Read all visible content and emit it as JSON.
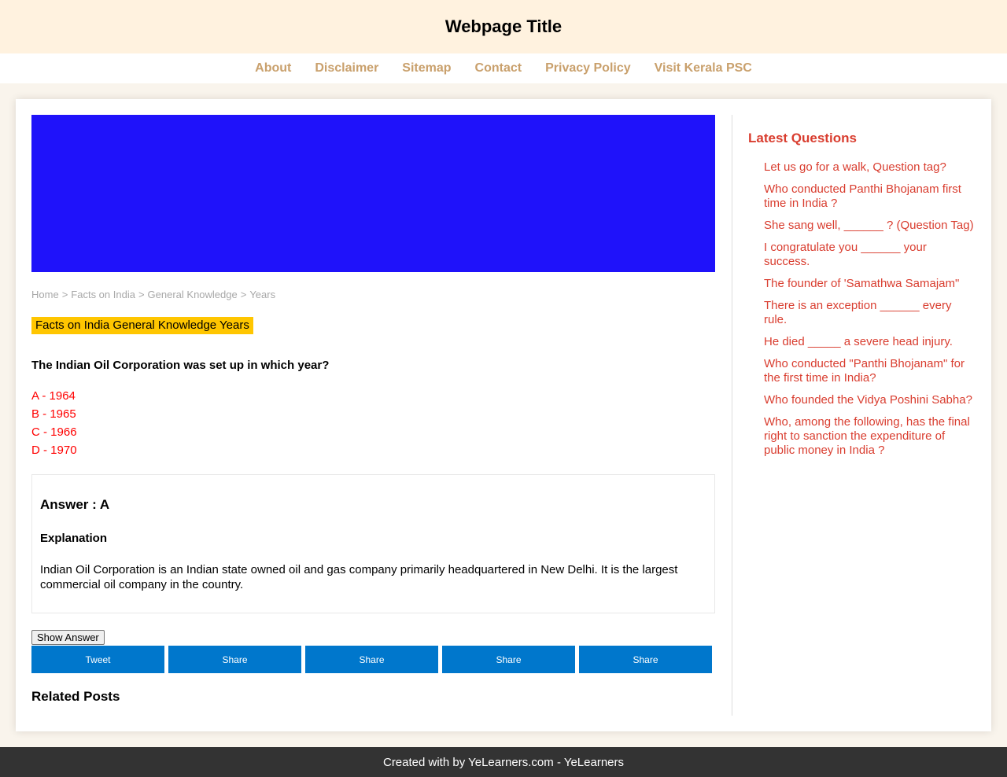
{
  "header": {
    "title": "Webpage Title"
  },
  "nav": [
    {
      "label": "About"
    },
    {
      "label": "Disclaimer"
    },
    {
      "label": "Sitemap"
    },
    {
      "label": "Contact"
    },
    {
      "label": "Privacy Policy"
    },
    {
      "label": "Visit Kerala PSC"
    }
  ],
  "colors": {
    "header_bg": "#fff2df",
    "nav_link": "#c9a06c",
    "banner": "#1f12fa",
    "tag_bg": "#ffc600",
    "option_text": "#ff0000",
    "share_bg": "#0077cc",
    "sidebar_link": "#d93d2f",
    "footer_bg": "#333333"
  },
  "breadcrumb": [
    "Home",
    "Facts on India",
    "General Knowledge",
    "Years"
  ],
  "tag": "Facts on India General Knowledge Years",
  "question": "The Indian Oil Corporation was set up in which year?",
  "options": [
    "A - 1964",
    "B - 1965",
    "C - 1966",
    "D - 1970"
  ],
  "answer": {
    "title": "Answer : A",
    "explanation_title": "Explanation",
    "explanation": "Indian Oil Corporation is an Indian state owned oil and gas company primarily headquartered in New Delhi. It is the largest commercial oil company in the country."
  },
  "show_answer_label": "Show Answer",
  "share_buttons": [
    "Tweet",
    "Share",
    "Share",
    "Share",
    "Share"
  ],
  "related_title": "Related Posts",
  "sidebar": {
    "title": "Latest Questions",
    "items": [
      "Let us go for a walk, Question tag?",
      "Who conducted Panthi Bhojanam first time in India ?",
      "She sang well, ______ ? (Question Tag)",
      "I congratulate you ______ your success.",
      "The founder of 'Samathwa Samajam\"",
      "There is an exception ______ every rule.",
      "He died _____ a severe head injury.",
      "Who conducted \"Panthi Bhojanam\" for the first time in India?",
      "Who founded the Vidya Poshini Sabha?",
      "Who, among the following, has the final right to sanction the expenditure of public money in India ?"
    ]
  },
  "footer": "Created with by YeLearners.com - YeLearners"
}
